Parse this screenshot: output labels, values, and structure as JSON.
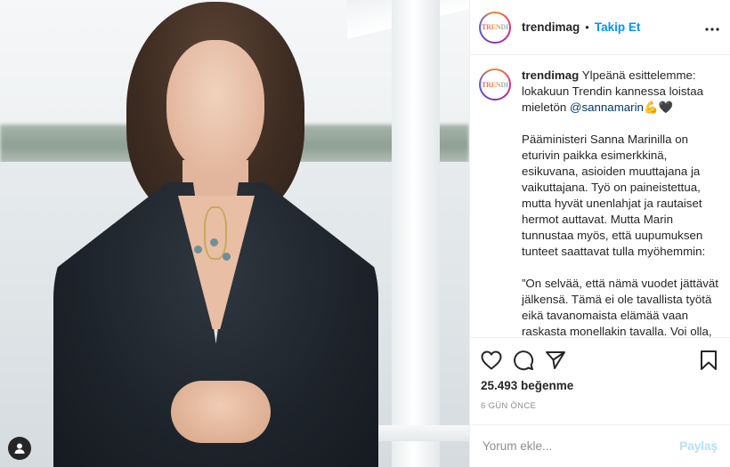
{
  "account": {
    "username": "trendimag",
    "avatar_text": "TRENDI",
    "follow_label": "Takip Et",
    "separator": "•",
    "more_icon": "more-horizontal-icon"
  },
  "caption": {
    "username": "trendimag",
    "intro": "Ylpeänä esittelemme: lokakuun Trendin kannessa loistaa mieletön",
    "mention": "@sannamarin",
    "emoji": "💪🖤",
    "paragraph_1": "Pääministeri Sanna Marinilla on eturivin paikka esimerkkinä, esikuvana, asioiden muuttajana ja vaikuttajana. Työ on paineistettua, mutta hyvät unenlahjat ja rautaiset hermot auttavat. Mutta Marin tunnustaa myös, että uupumuksen tunteet saattavat tulla myöhemmin:",
    "paragraph_2": "”On selvää, että nämä vuodet jättävät jälkensä. Tämä ei ole tavallista työtä eikä tavanomaista elämää vaan raskasta monellakin tavalla. Voi olla, että paine ja uupumus kertyvät ja tulevat myöhemmin. Tilanteissa on ollut pakko laittaa tunteet sivuun, mutta kyllähän ne kasautuvat.”"
  },
  "actions": {
    "like_icon": "heart-icon",
    "comment_icon": "comment-icon",
    "share_icon": "paper-plane-icon",
    "save_icon": "bookmark-icon"
  },
  "likes_text": "25.493 beğenme",
  "time_text": "6 GÜN ÖNCE",
  "comment_input": {
    "placeholder": "Yorum ekle...",
    "value": ""
  },
  "post_button_label": "Paylaş",
  "colors": {
    "follow_blue": "#0095f6",
    "post_disabled": "#b2dffc",
    "mention": "#00376b",
    "muted": "#8e8e8e"
  }
}
